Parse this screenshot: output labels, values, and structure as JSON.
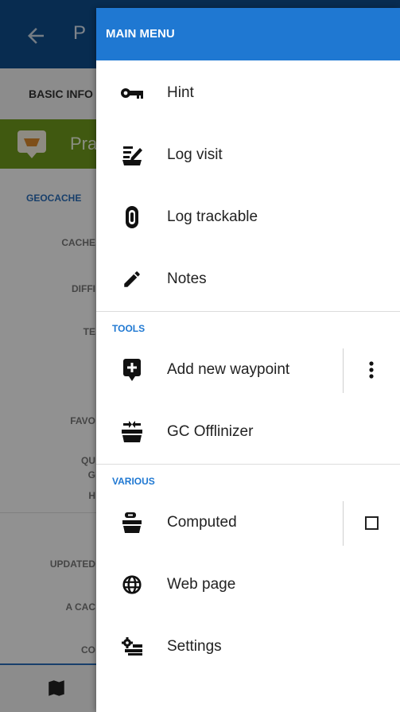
{
  "background": {
    "title_fragment": "P",
    "tab_label": "BASIC INFO",
    "green_bar_text": "Pra",
    "section_label": "GEOCACHE",
    "rows": [
      "CACHE",
      "DIFFI",
      "TE",
      "FAVO",
      "QU",
      "G",
      "H",
      "UPDATED",
      "A CAC",
      "CO"
    ]
  },
  "drawer": {
    "header": "MAIN MENU",
    "main_items": [
      {
        "label": "Hint",
        "icon": "key-icon"
      },
      {
        "label": "Log visit",
        "icon": "log-visit-icon"
      },
      {
        "label": "Log trackable",
        "icon": "trackable-icon"
      },
      {
        "label": "Notes",
        "icon": "pencil-icon"
      }
    ],
    "tools_title": "TOOLS",
    "tools_items": [
      {
        "label": "Add new waypoint",
        "icon": "add-waypoint-icon",
        "trailing": "more-vert-icon"
      },
      {
        "label": "GC Offlinizer",
        "icon": "offlinizer-icon"
      }
    ],
    "various_title": "VARIOUS",
    "various_items": [
      {
        "label": "Computed",
        "icon": "computed-icon",
        "trailing": "checkbox",
        "checked": false
      },
      {
        "label": "Web page",
        "icon": "globe-icon"
      },
      {
        "label": "Settings",
        "icon": "settings-icon"
      }
    ]
  },
  "colors": {
    "header_blue": "#1f78d2",
    "appbar_blue": "#0f4c8a",
    "green_bar": "#6f9a1d"
  }
}
